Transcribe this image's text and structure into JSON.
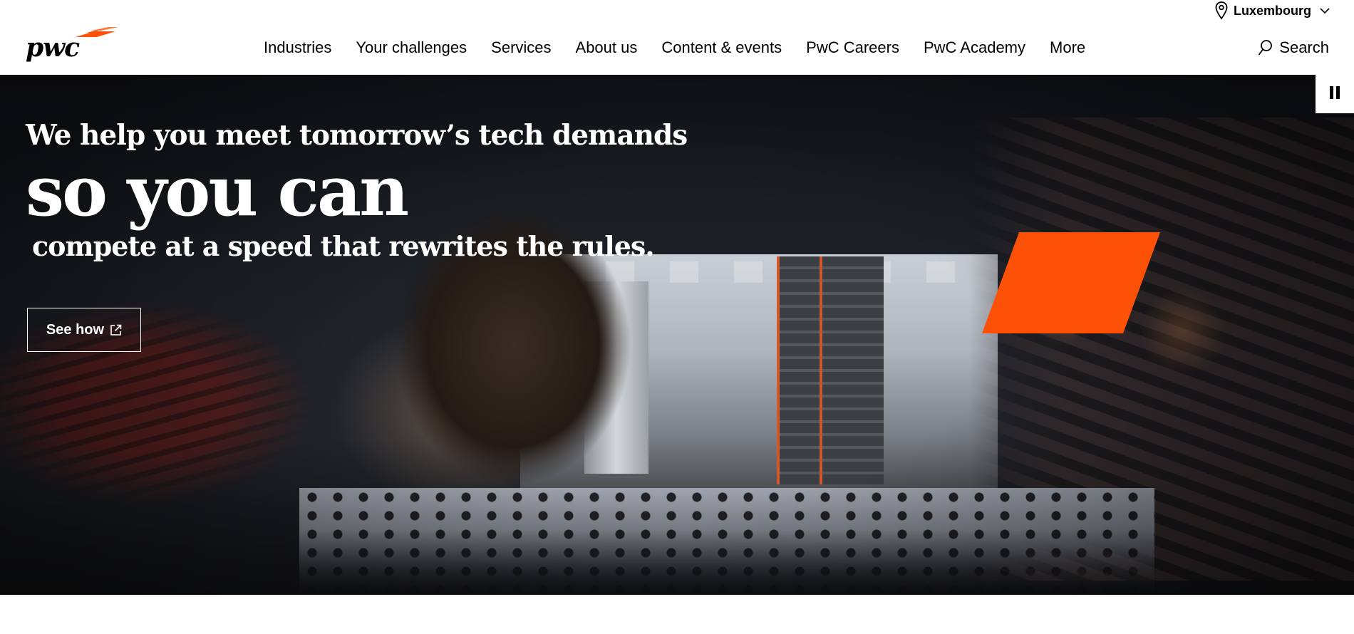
{
  "header": {
    "location": "Luxembourg",
    "logo_text": "pwc",
    "search_label": "Search",
    "nav": [
      {
        "label": "Industries"
      },
      {
        "label": "Your challenges"
      },
      {
        "label": "Services"
      },
      {
        "label": "About us"
      },
      {
        "label": "Content & events"
      },
      {
        "label": "PwC Careers"
      },
      {
        "label": "PwC Academy"
      },
      {
        "label": "More"
      }
    ]
  },
  "hero": {
    "line1": "We help you meet tomorrow’s tech demands",
    "line2": "so you can",
    "line3": "compete at a speed that rewrites the rules.",
    "cta_label": "See how",
    "accent_color": "#fd5108"
  },
  "colors": {
    "brand_orange": "#fd5108",
    "brand_orange_light": "#fe7c39",
    "header_bg": "#ffffff",
    "text_dark": "#000000"
  },
  "icons": {
    "location": "map-pin-icon",
    "chevron": "chevron-down-icon",
    "search": "search-icon",
    "external": "external-link-icon",
    "pause": "pause-icon"
  }
}
